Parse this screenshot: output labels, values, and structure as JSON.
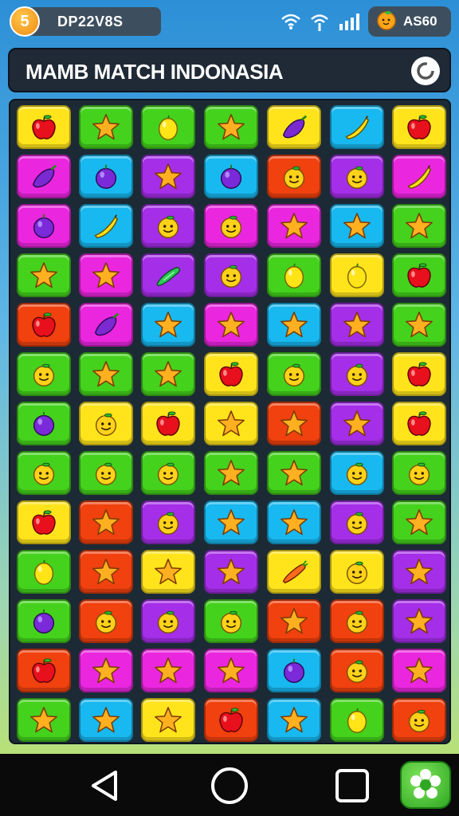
{
  "status": {
    "level": "5",
    "code": "DP22V8S",
    "coins": "AS60"
  },
  "header": {
    "title": "MAMB MATCH INDONASIA"
  },
  "colors": {
    "yellow": "#ffe41c",
    "green": "#44d21c",
    "magenta": "#ea26df",
    "blue": "#18b8f0",
    "red": "#f0410e",
    "purple": "#a52ee8"
  },
  "board": {
    "rows": [
      [
        [
          "yellow",
          "apple"
        ],
        [
          "green",
          "star"
        ],
        [
          "green",
          "lemon"
        ],
        [
          "green",
          "star"
        ],
        [
          "yellow",
          "eggplant"
        ],
        [
          "blue",
          "banana"
        ],
        [
          "yellow",
          "apple"
        ]
      ],
      [
        [
          "magenta",
          "eggplant"
        ],
        [
          "blue",
          "plum"
        ],
        [
          "purple",
          "star"
        ],
        [
          "blue",
          "plum"
        ],
        [
          "red",
          "face"
        ],
        [
          "purple",
          "face"
        ],
        [
          "magenta",
          "banana"
        ]
      ],
      [
        [
          "magenta",
          "plum"
        ],
        [
          "blue",
          "banana"
        ],
        [
          "purple",
          "face"
        ],
        [
          "magenta",
          "face"
        ],
        [
          "magenta",
          "star"
        ],
        [
          "blue",
          "star"
        ],
        [
          "green",
          "star"
        ]
      ],
      [
        [
          "green",
          "star"
        ],
        [
          "magenta",
          "star"
        ],
        [
          "purple",
          "cucumber"
        ],
        [
          "purple",
          "face"
        ],
        [
          "green",
          "lemon"
        ],
        [
          "yellow",
          "lemon"
        ],
        [
          "green",
          "apple"
        ]
      ],
      [
        [
          "red",
          "apple"
        ],
        [
          "magenta",
          "eggplant"
        ],
        [
          "blue",
          "star"
        ],
        [
          "magenta",
          "star"
        ],
        [
          "blue",
          "star"
        ],
        [
          "purple",
          "star"
        ],
        [
          "green",
          "star"
        ]
      ],
      [
        [
          "green",
          "face"
        ],
        [
          "green",
          "star"
        ],
        [
          "green",
          "star"
        ],
        [
          "yellow",
          "apple"
        ],
        [
          "green",
          "face"
        ],
        [
          "purple",
          "face"
        ],
        [
          "yellow",
          "apple"
        ]
      ],
      [
        [
          "green",
          "plum"
        ],
        [
          "yellow",
          "face"
        ],
        [
          "yellow",
          "apple"
        ],
        [
          "yellow",
          "star"
        ],
        [
          "red",
          "star"
        ],
        [
          "purple",
          "star"
        ],
        [
          "yellow",
          "apple"
        ]
      ],
      [
        [
          "green",
          "face"
        ],
        [
          "green",
          "face"
        ],
        [
          "green",
          "face"
        ],
        [
          "green",
          "star"
        ],
        [
          "green",
          "star"
        ],
        [
          "blue",
          "face"
        ],
        [
          "green",
          "face"
        ]
      ],
      [
        [
          "yellow",
          "apple"
        ],
        [
          "red",
          "star"
        ],
        [
          "purple",
          "face"
        ],
        [
          "blue",
          "star"
        ],
        [
          "blue",
          "star"
        ],
        [
          "purple",
          "face"
        ],
        [
          "green",
          "star"
        ]
      ],
      [
        [
          "green",
          "lemon"
        ],
        [
          "red",
          "star"
        ],
        [
          "yellow",
          "star"
        ],
        [
          "purple",
          "star"
        ],
        [
          "yellow",
          "carrot"
        ],
        [
          "yellow",
          "face"
        ],
        [
          "purple",
          "star"
        ]
      ],
      [
        [
          "green",
          "plum"
        ],
        [
          "red",
          "face"
        ],
        [
          "purple",
          "face"
        ],
        [
          "green",
          "face"
        ],
        [
          "red",
          "star"
        ],
        [
          "red",
          "face"
        ],
        [
          "purple",
          "star"
        ]
      ],
      [
        [
          "red",
          "apple"
        ],
        [
          "magenta",
          "star"
        ],
        [
          "magenta",
          "star"
        ],
        [
          "magenta",
          "star"
        ],
        [
          "blue",
          "plum"
        ],
        [
          "red",
          "face"
        ],
        [
          "magenta",
          "star"
        ]
      ],
      [
        [
          "green",
          "star"
        ],
        [
          "blue",
          "star"
        ],
        [
          "yellow",
          "star"
        ],
        [
          "red",
          "apple"
        ],
        [
          "blue",
          "star"
        ],
        [
          "green",
          "lemon"
        ],
        [
          "red",
          "face"
        ]
      ]
    ]
  },
  "navigation": {
    "icons": [
      "back-icon",
      "home-icon",
      "recents-icon",
      "flower-icon"
    ]
  }
}
